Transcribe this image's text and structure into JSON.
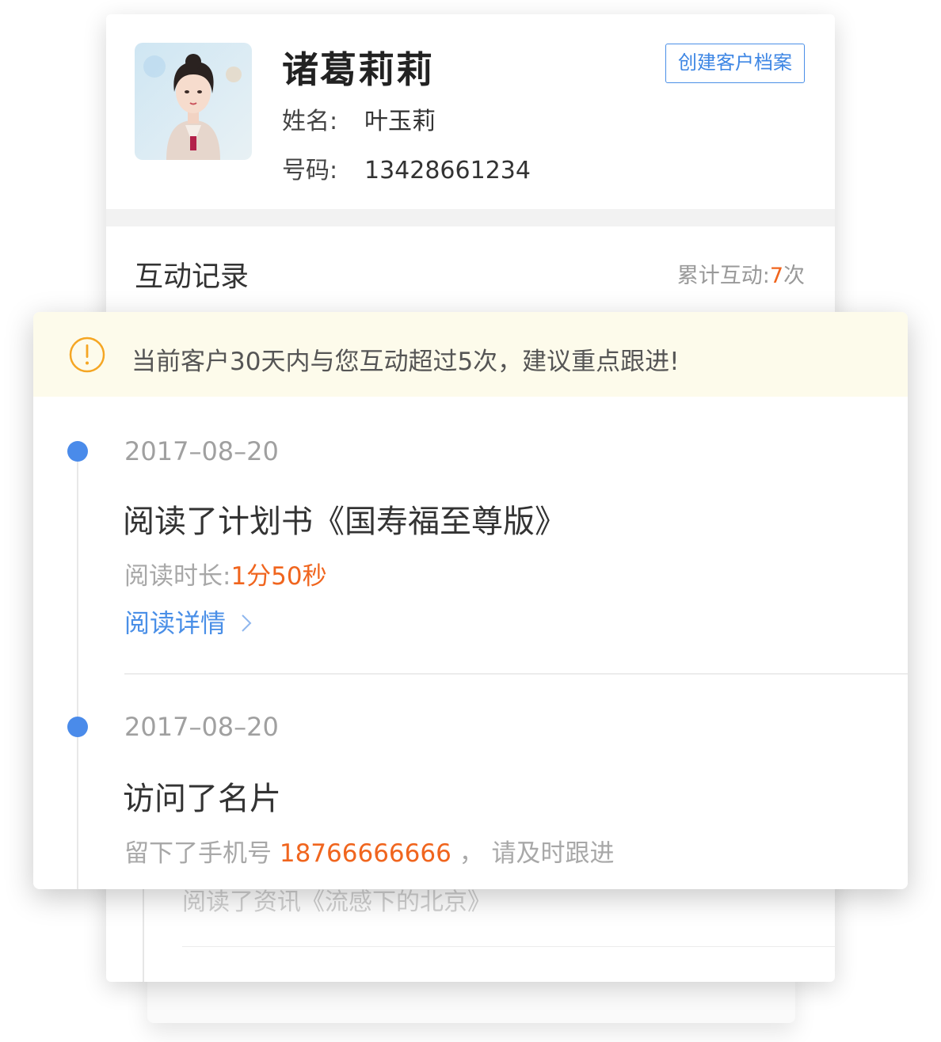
{
  "profile": {
    "display_name": "诸葛莉莉",
    "name_label": "姓名:",
    "name_value": "叶玉莉",
    "phone_label": "号码:",
    "phone_value": "13428661234",
    "create_button": "创建客户档案"
  },
  "interactions": {
    "section_title": "互动记录",
    "total_label": "累计互动:",
    "total_count": "7",
    "total_unit": "次"
  },
  "notice": {
    "icon": "warning-icon",
    "text": "当前客户30天内与您互动超过5次，建议重点跟进!"
  },
  "timeline": [
    {
      "date": "2017–08–20",
      "title": "阅读了计划书《国寿福至尊版》",
      "detail_label": "阅读时长:",
      "detail_value": "1分50秒",
      "link_label": "阅读详情"
    },
    {
      "date": "2017–08–20",
      "title": "访问了名片",
      "detail_prefix": "留下了手机号",
      "detail_phone": "18766666666",
      "detail_suffix": "，  请及时跟进"
    }
  ],
  "back_item": {
    "title": "阅读了资讯《流感下的北京》"
  },
  "colors": {
    "accent_blue": "#4a8fe7",
    "highlight_orange": "#f0651e",
    "notice_bg": "#fdfbeb",
    "warning_orange": "#f5a623"
  }
}
